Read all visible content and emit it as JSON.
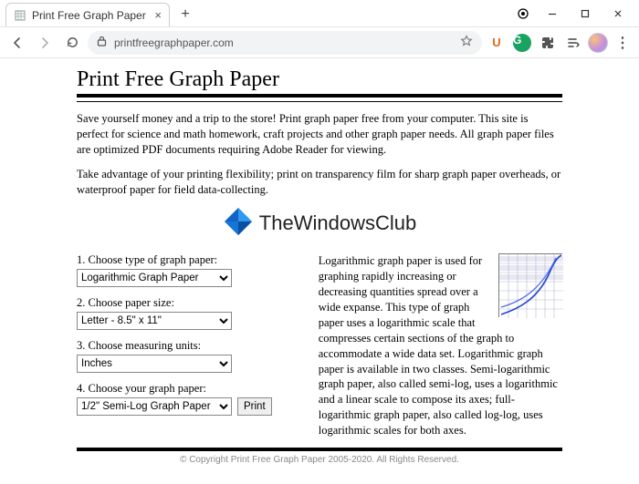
{
  "browser": {
    "tab_title": "Print Free Graph Paper",
    "url": "printfreegraphpaper.com"
  },
  "page_title": "Print Free Graph Paper",
  "intro": {
    "p1": "Save yourself money and a trip to the store! Print graph paper free from your computer. This site is perfect for science and math homework, craft projects and other graph paper needs. All graph paper files are optimized PDF documents requiring Adobe Reader for viewing.",
    "p2": "Take advantage of your printing flexibility; print on transparency film for sharp graph paper overheads, or waterproof paper for field data-collecting."
  },
  "brand": "TheWindowsClub",
  "form": {
    "step1_label": "1. Choose type of graph paper:",
    "step1_value": "Logarithmic Graph Paper",
    "step2_label": "2. Choose paper size:",
    "step2_value": "Letter - 8.5\" x 11\"",
    "step3_label": "3. Choose measuring units:",
    "step3_value": "Inches",
    "step4_label": "4. Choose your graph paper:",
    "step4_value": "1/2\" Semi-Log Graph Paper",
    "print_label": "Print"
  },
  "description": "Logarithmic graph paper is used for graphing rapidly increasing or decreasing quantities spread over a wide expanse. This type of graph paper uses a logarithmic scale that compresses certain sections of the graph to accommodate a wide data set. Logarithmic graph paper is available in two classes. Semi-logarithmic graph paper, also called semi-log, uses a logarithmic and a linear scale to compose its axes; full-logarithmic graph paper, also called log-log, uses logarithmic scales for both axes.",
  "footer": "© Copyright Print Free Graph Paper 2005-2020. All Rights Reserved."
}
